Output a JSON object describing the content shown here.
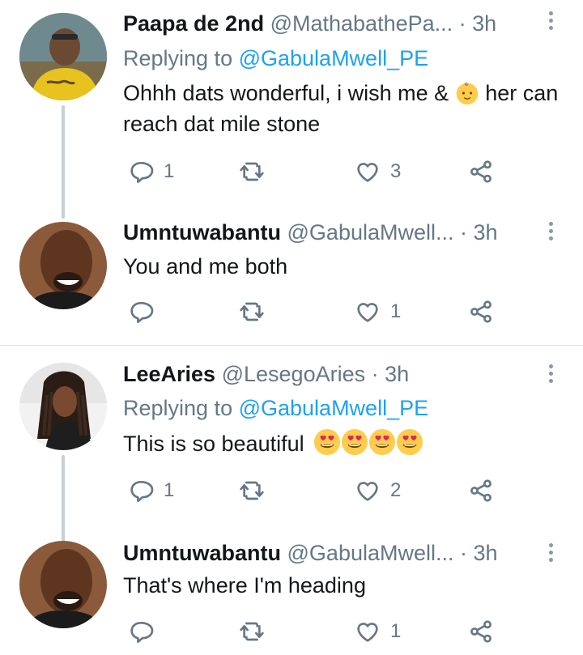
{
  "tweets": [
    {
      "name": "Paapa de 2nd",
      "handle": "@MathabathePa...",
      "time": "· 3h",
      "replying_label": "Replying to ",
      "replying_to": "@GabulaMwell_PE",
      "text_before": "Ohhh dats wonderful, i wish me &",
      "text_emoji": "baby-face-emoji",
      "text_after": "her can reach dat mile stone",
      "reply_count": "1",
      "retweet_count": "",
      "like_count": "3"
    },
    {
      "name": "Umntuwabantu",
      "handle": "@GabulaMwell...",
      "time": "· 3h",
      "text": "You and me both",
      "reply_count": "",
      "retweet_count": "",
      "like_count": "1"
    },
    {
      "name": "LeeAries",
      "handle": "@LesegoAries",
      "time": "· 3h",
      "replying_label": "Replying to ",
      "replying_to": "@GabulaMwell_PE",
      "text": "This is so beautiful",
      "text_emoji": "heart-eyes-emoji",
      "text_emoji_count": 4,
      "reply_count": "1",
      "retweet_count": "",
      "like_count": "2"
    },
    {
      "name": "Umntuwabantu",
      "handle": "@GabulaMwell...",
      "time": "· 3h",
      "text": "That's where I'm heading",
      "reply_count": "",
      "retweet_count": "",
      "like_count": "1"
    }
  ],
  "icons": {
    "reply": "reply-icon",
    "retweet": "retweet-icon",
    "like": "like-icon",
    "share": "share-icon",
    "more": "more-icon"
  },
  "colors": {
    "link": "#1da1f2",
    "muted": "#657786",
    "thread_line": "#c7d0d7"
  }
}
